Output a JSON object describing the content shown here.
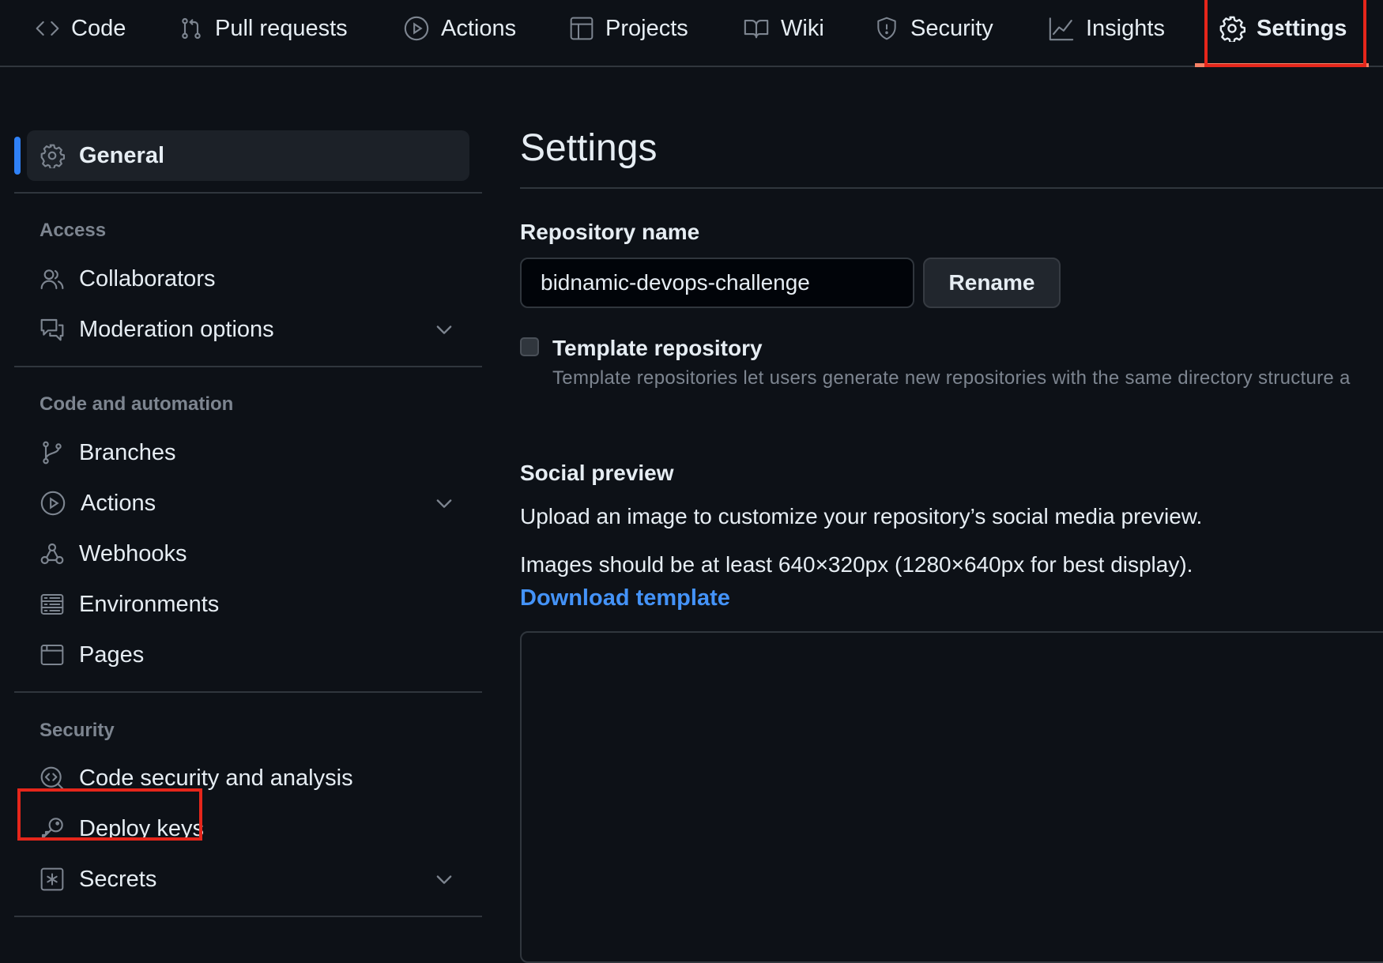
{
  "nav": {
    "tabs": [
      {
        "label": "Code",
        "icon": "code-icon"
      },
      {
        "label": "Pull requests",
        "icon": "git-pull-request-icon"
      },
      {
        "label": "Actions",
        "icon": "play-icon"
      },
      {
        "label": "Projects",
        "icon": "table-icon"
      },
      {
        "label": "Wiki",
        "icon": "book-icon"
      },
      {
        "label": "Security",
        "icon": "shield-icon"
      },
      {
        "label": "Insights",
        "icon": "graph-icon"
      },
      {
        "label": "Settings",
        "icon": "gear-icon",
        "active": true
      }
    ]
  },
  "sidebar": {
    "general": "General",
    "sections": {
      "access": "Access",
      "code_automation": "Code and automation",
      "security": "Security"
    },
    "items": {
      "collaborators": "Collaborators",
      "moderation": "Moderation options",
      "branches": "Branches",
      "actions": "Actions",
      "webhooks": "Webhooks",
      "environments": "Environments",
      "pages": "Pages",
      "code_security": "Code security and analysis",
      "deploy_keys": "Deploy keys",
      "secrets": "Secrets"
    }
  },
  "main": {
    "title": "Settings",
    "repo_name_label": "Repository name",
    "repo_name_value": "bidnamic-devops-challenge",
    "rename_label": "Rename",
    "template_label": "Template repository",
    "template_desc": "Template repositories let users generate new repositories with the same directory structure a",
    "social_label": "Social preview",
    "social_text1": "Upload an image to customize your repository’s social media preview.",
    "social_text2": "Images should be at least 640×320px (1280×640px for best display).",
    "download_link": "Download template"
  },
  "colors": {
    "background": "#0d1117",
    "accent_blue": "#2f81f7",
    "link_blue": "#4493f8",
    "highlight_red": "#e5261b",
    "border": "#30363d",
    "muted": "#7d8590"
  }
}
